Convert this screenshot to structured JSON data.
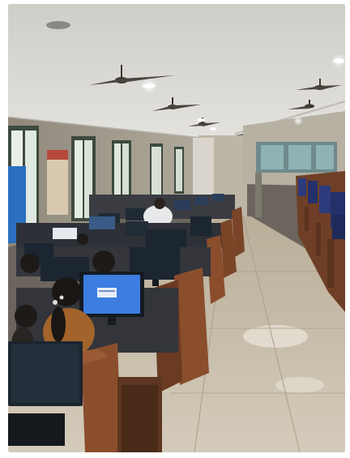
{
  "scene": {
    "colors": {
      "ceiling": "#d6d4cf",
      "wall": "#a9a398",
      "floor": "#c7bdaa",
      "desk_wood": "#8a4e2d",
      "monitor_dark": "#1c2630",
      "screen_blue": "#3b7de0",
      "window_light": "#e9efe8",
      "door_blue": "#2a6fc0",
      "chair_blue": "#2c3b7c"
    },
    "icons": [
      "ceiling-fan-icon",
      "ceiling-light-icon"
    ]
  }
}
